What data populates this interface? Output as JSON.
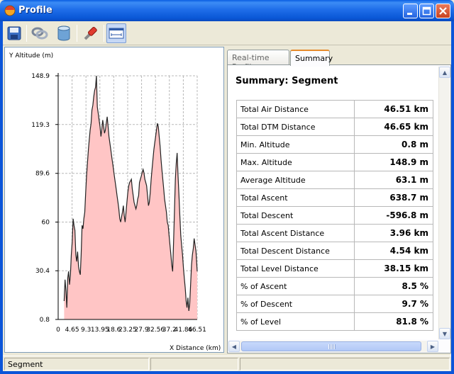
{
  "window": {
    "title": "Profile"
  },
  "toolbar": {
    "buttons": [
      {
        "icon": "save-icon"
      },
      {
        "icon": "link-icon"
      },
      {
        "icon": "database-icon"
      },
      {
        "icon": "profile-tool-icon"
      },
      {
        "icon": "segment-view-icon",
        "active": true
      }
    ]
  },
  "chart_data": {
    "type": "area",
    "ylabel": "Y Altitude (m)",
    "xlabel": "X Distance (km)",
    "ylim": [
      0.8,
      148.9
    ],
    "xlim": [
      0,
      46.51
    ],
    "yticks": [
      "148.9",
      "119.3",
      "89.6",
      "60",
      "30.4",
      "0.8"
    ],
    "xticks": [
      "0",
      "4.65",
      "9.3",
      "13.95",
      "18.6",
      "23.25",
      "27.9",
      "32.56",
      "37.2",
      "41.86",
      "46.51"
    ],
    "grid": true,
    "fill_color": "#ffc5c5",
    "line_color": "#222222",
    "x": [
      2.0,
      2.3,
      2.6,
      2.9,
      3.2,
      3.5,
      3.8,
      4.1,
      4.4,
      4.7,
      5.0,
      5.3,
      5.6,
      5.9,
      6.2,
      6.5,
      6.8,
      7.1,
      7.4,
      7.7,
      8.0,
      8.3,
      8.6,
      8.9,
      9.2,
      9.5,
      9.8,
      10.1,
      10.4,
      10.7,
      11.0,
      11.3,
      11.6,
      11.9,
      12.2,
      12.5,
      12.8,
      13.1,
      13.4,
      13.7,
      14.0,
      14.3,
      14.6,
      14.9,
      15.2,
      15.5,
      15.8,
      16.1,
      16.4,
      16.7,
      17.0,
      17.3,
      17.6,
      17.9,
      18.2,
      18.5,
      18.8,
      19.1,
      19.4,
      19.7,
      20.0,
      20.3,
      20.6,
      20.9,
      21.2,
      21.5,
      21.8,
      22.1,
      22.4,
      22.7,
      23.0,
      23.3,
      23.6,
      23.9,
      24.2,
      24.5,
      24.8,
      25.1,
      25.4,
      25.7,
      26.0,
      26.3,
      26.6,
      26.9,
      27.2,
      27.5,
      27.8,
      28.1,
      28.4,
      28.7,
      29.0,
      29.3,
      29.6,
      29.9,
      30.2,
      30.5,
      30.8,
      31.1,
      31.4,
      31.7,
      32.0,
      32.3,
      32.6,
      32.9,
      33.2,
      33.5,
      33.8,
      34.1,
      34.4,
      34.7,
      35.0,
      35.3,
      35.6,
      35.9,
      36.2,
      36.5,
      36.8,
      37.1,
      37.4,
      37.7,
      38.0,
      38.3,
      38.6,
      38.9,
      39.2,
      39.5,
      39.8,
      40.1,
      40.4,
      40.7,
      41.0,
      41.3,
      41.6,
      41.9,
      42.2,
      42.5,
      42.8,
      43.1,
      43.4,
      43.7,
      44.0,
      44.3,
      44.6,
      44.9,
      45.2,
      45.5,
      45.8,
      46.1,
      46.5
    ],
    "y": [
      12,
      25,
      18,
      8,
      26,
      30,
      22,
      28,
      40,
      48,
      62,
      58,
      55,
      40,
      36,
      42,
      33,
      30,
      28,
      40,
      58,
      56,
      62,
      66,
      78,
      88,
      96,
      104,
      110,
      116,
      120,
      128,
      131,
      136,
      140,
      142,
      148.9,
      130,
      126,
      122,
      118,
      112,
      116,
      122,
      118,
      114,
      116,
      120,
      124,
      118,
      112,
      108,
      104,
      100,
      96,
      92,
      88,
      84,
      80,
      76,
      72,
      68,
      62,
      60,
      63,
      66,
      70,
      64,
      60,
      66,
      72,
      78,
      82,
      84,
      85,
      86,
      80,
      76,
      72,
      70,
      68,
      70,
      74,
      76,
      84,
      86,
      88,
      90,
      92,
      90,
      86,
      84,
      82,
      76,
      70,
      72,
      78,
      86,
      92,
      98,
      104,
      108,
      112,
      116,
      120,
      118,
      112,
      106,
      98,
      92,
      86,
      80,
      74,
      70,
      66,
      60,
      58,
      52,
      46,
      40,
      34,
      30,
      48,
      66,
      86,
      96,
      102,
      88,
      76,
      64,
      52,
      46,
      40,
      32,
      26,
      20,
      12,
      8,
      14,
      6,
      10,
      22,
      34,
      40,
      44,
      50,
      46,
      42,
      30,
      20
    ]
  },
  "summary": {
    "tabs": [
      "Real-time Profile",
      "Summary"
    ],
    "title": "Summary: Segment",
    "rows": [
      {
        "label": "Total Air Distance",
        "value": "46.51 km"
      },
      {
        "label": "Total DTM Distance",
        "value": "46.65 km"
      },
      {
        "label": "Min. Altitude",
        "value": "0.8 m"
      },
      {
        "label": "Max. Altitude",
        "value": "148.9 m"
      },
      {
        "label": "Average Altitude",
        "value": "63.1 m"
      },
      {
        "label": "Total Ascent",
        "value": "638.7 m"
      },
      {
        "label": "Total Descent",
        "value": "-596.8 m"
      },
      {
        "label": "Total Ascent Distance",
        "value": "3.96 km"
      },
      {
        "label": "Total Descent Distance",
        "value": "4.54 km"
      },
      {
        "label": "Total Level Distance",
        "value": "38.15 km"
      },
      {
        "label": "% of Ascent",
        "value": "8.5 %"
      },
      {
        "label": "% of Descent",
        "value": "9.7 %"
      },
      {
        "label": "% of Level",
        "value": "81.8 %"
      }
    ]
  },
  "statusbar": {
    "text": "Segment"
  }
}
